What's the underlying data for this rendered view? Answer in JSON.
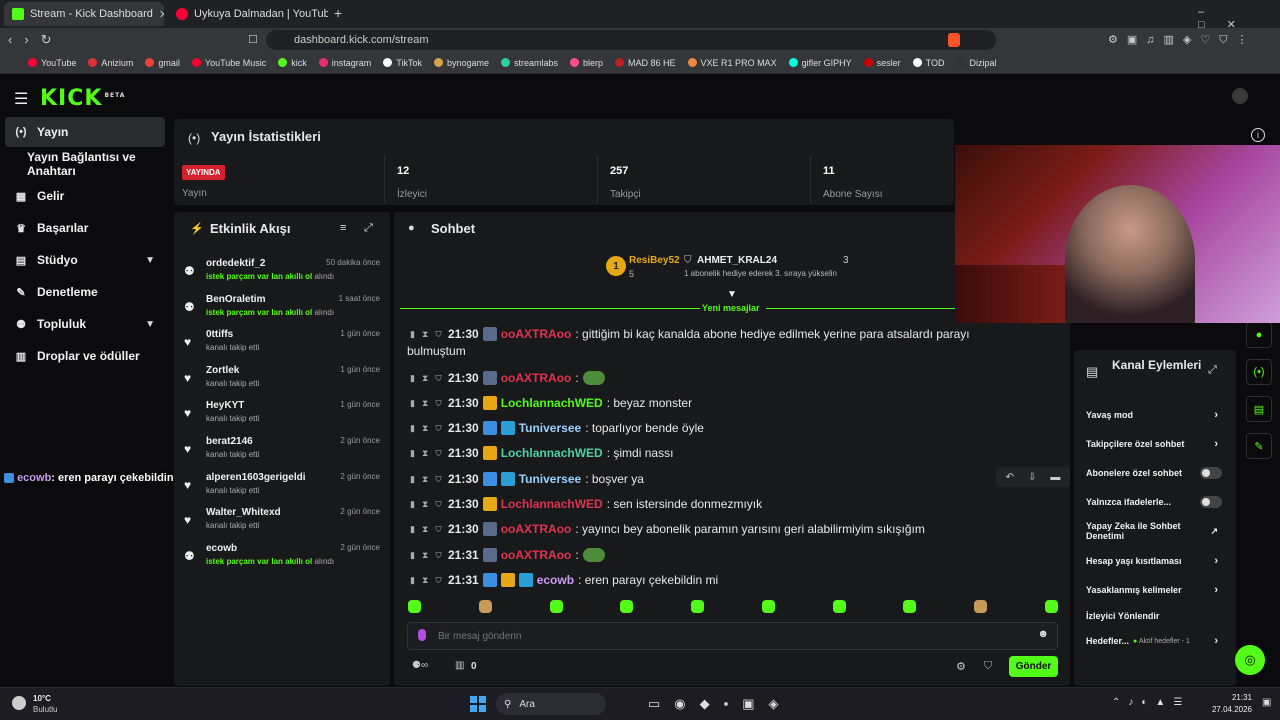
{
  "browser": {
    "tabs": [
      {
        "label": "Stream - Kick Dashboard",
        "active": true
      },
      {
        "label": "Uykuya Dalmadan | YouTube Mus",
        "active": false
      }
    ],
    "url": "dashboard.kick.com/stream",
    "bookmarks": [
      "YouTube",
      "Anizium",
      "gmail",
      "YouTube Music",
      "kick",
      "instagram",
      "TikTok",
      "bynogame",
      "streamlabs",
      "blerp",
      "MAD 86 HE",
      "VXE R1 PRO MAX",
      "gifler GIPHY",
      "sesler",
      "TOD",
      "Dizipal"
    ]
  },
  "app": {
    "logo": "KICK",
    "logo_sup": "BETA"
  },
  "sidebar": {
    "items": [
      {
        "label": "Yayın",
        "icon": "broadcast-icon"
      },
      {
        "label": "Yayın Bağlantısı ve Anahtarı",
        "icon": ""
      },
      {
        "label": "Gelir",
        "icon": "revenue-icon"
      },
      {
        "label": "Başarılar",
        "icon": "trophy-icon"
      },
      {
        "label": "Stüdyo",
        "icon": "studio-icon"
      },
      {
        "label": "Denetleme",
        "icon": "wrench-icon"
      },
      {
        "label": "Topluluk",
        "icon": "community-icon"
      },
      {
        "label": "Droplar ve ödüller",
        "icon": "gift-icon"
      }
    ]
  },
  "stats": {
    "title": "Yayın İstatistikleri",
    "live_badge": "YAYINDA",
    "live_label": "Yayın",
    "viewers": {
      "value": "12",
      "label": "İzleyici"
    },
    "followers": {
      "value": "257",
      "label": "Takipçi"
    },
    "subs": {
      "value": "11",
      "label": "Abone Sayısı"
    }
  },
  "activity": {
    "title": "Etkinlik Akışı",
    "items": [
      {
        "name": "ordedektif_2",
        "time": "50 dakika önce",
        "action_hl": "istek parçam var lan akıllı ol",
        "action": "alındı"
      },
      {
        "name": "BenOraletim",
        "time": "1 saat önce",
        "action_hl": "istek parçam var lan akıllı ol",
        "action": "alındı"
      },
      {
        "name": "0ttiffs",
        "time": "1 gün önce",
        "action_hl": "",
        "action": "kanalı takip etti"
      },
      {
        "name": "Zortlek",
        "time": "1 gün önce",
        "action_hl": "",
        "action": "kanalı takip etti"
      },
      {
        "name": "HeyKYT",
        "time": "1 gün önce",
        "action_hl": "",
        "action": "kanalı takip etti"
      },
      {
        "name": "berat2146",
        "time": "2 gün önce",
        "action_hl": "",
        "action": "kanalı takip etti"
      },
      {
        "name": "alperen1603gerigeldi",
        "time": "2 gün önce",
        "action_hl": "",
        "action": "kanalı takip etti"
      },
      {
        "name": "Walter_Whitexd",
        "time": "2 gün önce",
        "action_hl": "",
        "action": "kanalı takip etti"
      },
      {
        "name": "ecowb",
        "time": "2 gün önce",
        "action_hl": "istek parçam var lan akıllı ol",
        "action": "alındı"
      }
    ]
  },
  "overlay_chat": {
    "user": "ecowb",
    "text": ": eren parayı çekebildin mi"
  },
  "chat": {
    "title": "Sohbet",
    "leader1": {
      "name": "ResiBey52",
      "count": "5"
    },
    "leader2": {
      "name": "AHMET_KRAL24",
      "count": "3",
      "note": "1 abonelik hediye ederek 3. sıraya yükselin"
    },
    "new_messages": "Yeni mesajlar",
    "messages": [
      {
        "time": "21:30",
        "user": "ooAXTRAoo",
        "color": "#e0334f",
        "text": ": gittiğim bi kaç kanalda abone hediye edilmek yerine para atsalardı parayı",
        "cont": "bulmuştum"
      },
      {
        "time": "21:30",
        "user": "ooAXTRAoo",
        "color": "#e0334f",
        "text": ":",
        "cont": ""
      },
      {
        "time": "21:30",
        "user": "LochlannachWED",
        "color": "#53fc18",
        "text": ": beyaz monster",
        "cont": ""
      },
      {
        "time": "21:30",
        "user": "Tuniversee",
        "color": "#9ad0ff",
        "text": ": toparlıyor bende öyle",
        "cont": ""
      },
      {
        "time": "21:30",
        "user": "LochlannachWED",
        "color": "#4fd1a5",
        "text": ": şimdi nassı",
        "cont": ""
      },
      {
        "time": "21:30",
        "user": "Tuniversee",
        "color": "#9ad0ff",
        "text": ": boşver ya",
        "cont": ""
      },
      {
        "time": "21:30",
        "user": "LochlannachWED",
        "color": "#e0334f",
        "text": ": sen istersinde donmezmıyık",
        "cont": ""
      },
      {
        "time": "21:30",
        "user": "ooAXTRAoo",
        "color": "#e0334f",
        "text": ": yayıncı bey abonelik paramın yarısını geri alabilirmiyim sıkışığım",
        "cont": ""
      },
      {
        "time": "21:31",
        "user": "ooAXTRAoo",
        "color": "#e0334f",
        "text": ":",
        "cont": ""
      },
      {
        "time": "21:31",
        "user": "ecowb",
        "color": "#c99cf0",
        "text": ": eren parayı çekebildin mi",
        "cont": ""
      }
    ],
    "input_placeholder": "Bir mesaj gönderin",
    "points": "0",
    "send_label": "Gönder"
  },
  "channel_actions": {
    "title": "Kanal Eylemleri",
    "items": [
      {
        "label": "Yavaş mod",
        "type": "arrow"
      },
      {
        "label": "Takipçilere özel sohbet",
        "type": "arrow"
      },
      {
        "label": "Abonelere özel sohbet",
        "type": "toggle"
      },
      {
        "label": "Yalnızca ifadelerle...",
        "type": "toggle"
      },
      {
        "label": "Yapay Zeka ile Sohbet Denetimi",
        "type": "ext"
      },
      {
        "label": "Hesap yaşı kısıtlaması",
        "type": "arrow"
      },
      {
        "label": "Yasaklanmış kelimeler",
        "type": "arrow"
      },
      {
        "label": "İzleyici Yönlendir",
        "type": "none"
      },
      {
        "label": "Hedefler...",
        "type": "arrow",
        "extra": "Aktif hedefler - 1"
      }
    ]
  },
  "taskbar": {
    "weather_temp": "10°C",
    "weather_desc": "Bulutlu",
    "search": "Ara",
    "time": "21:31",
    "date": "27.04.2026"
  },
  "colors": {
    "accent": "#53fc18",
    "live": "#d61f2c",
    "panel": "#18191b"
  }
}
